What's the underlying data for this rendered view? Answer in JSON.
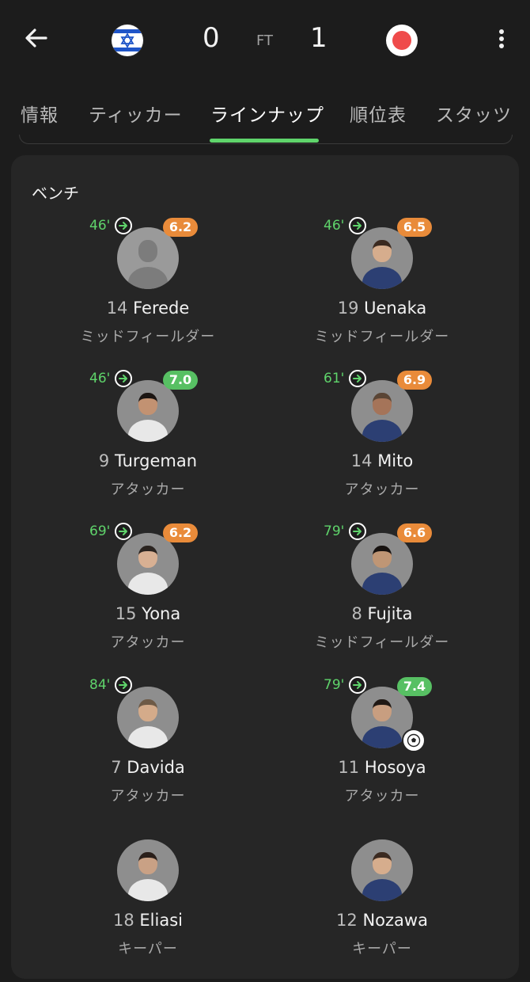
{
  "header": {
    "home_score": "0",
    "status": "FT",
    "away_score": "1",
    "home_flag_icon": "israel-flag-icon",
    "away_flag_icon": "japan-flag-icon"
  },
  "tabs": [
    {
      "label": "情報"
    },
    {
      "label": "ティッカー"
    },
    {
      "label": "ラインナップ"
    },
    {
      "label": "順位表"
    },
    {
      "label": "スタッツ"
    }
  ],
  "bench": {
    "title": "ベンチ",
    "players": [
      {
        "number": "14",
        "name": "Ferede",
        "position": "ミッドフィールダー",
        "sub_time": "46'",
        "rating": "6.2",
        "rating_color": "#e98b3a",
        "photo": "placeholder"
      },
      {
        "number": "19",
        "name": "Uenaka",
        "position": "ミッドフィールダー",
        "sub_time": "46'",
        "rating": "6.5",
        "rating_color": "#e98b3a",
        "photo": "photo"
      },
      {
        "number": "9",
        "name": "Turgeman",
        "position": "アタッカー",
        "sub_time": "46'",
        "rating": "7.0",
        "rating_color": "#57c063",
        "photo": "photo"
      },
      {
        "number": "14",
        "name": "Mito",
        "position": "アタッカー",
        "sub_time": "61'",
        "rating": "6.9",
        "rating_color": "#e98b3a",
        "photo": "photo"
      },
      {
        "number": "15",
        "name": "Yona",
        "position": "アタッカー",
        "sub_time": "69'",
        "rating": "6.2",
        "rating_color": "#e98b3a",
        "photo": "photo"
      },
      {
        "number": "8",
        "name": "Fujita",
        "position": "ミッドフィールダー",
        "sub_time": "79'",
        "rating": "6.6",
        "rating_color": "#e98b3a",
        "photo": "photo"
      },
      {
        "number": "7",
        "name": "Davida",
        "position": "アタッカー",
        "sub_time": "84'",
        "rating": "",
        "rating_color": "",
        "photo": "photo"
      },
      {
        "number": "11",
        "name": "Hosoya",
        "position": "アタッカー",
        "sub_time": "79'",
        "rating": "7.4",
        "rating_color": "#57c063",
        "photo": "photo",
        "goal": true
      },
      {
        "number": "18",
        "name": "Eliasi",
        "position": "キーパー",
        "sub_time": "",
        "rating": "",
        "rating_color": "",
        "photo": "photo"
      },
      {
        "number": "12",
        "name": "Nozawa",
        "position": "キーパー",
        "sub_time": "",
        "rating": "",
        "rating_color": "",
        "photo": "photo"
      }
    ]
  }
}
